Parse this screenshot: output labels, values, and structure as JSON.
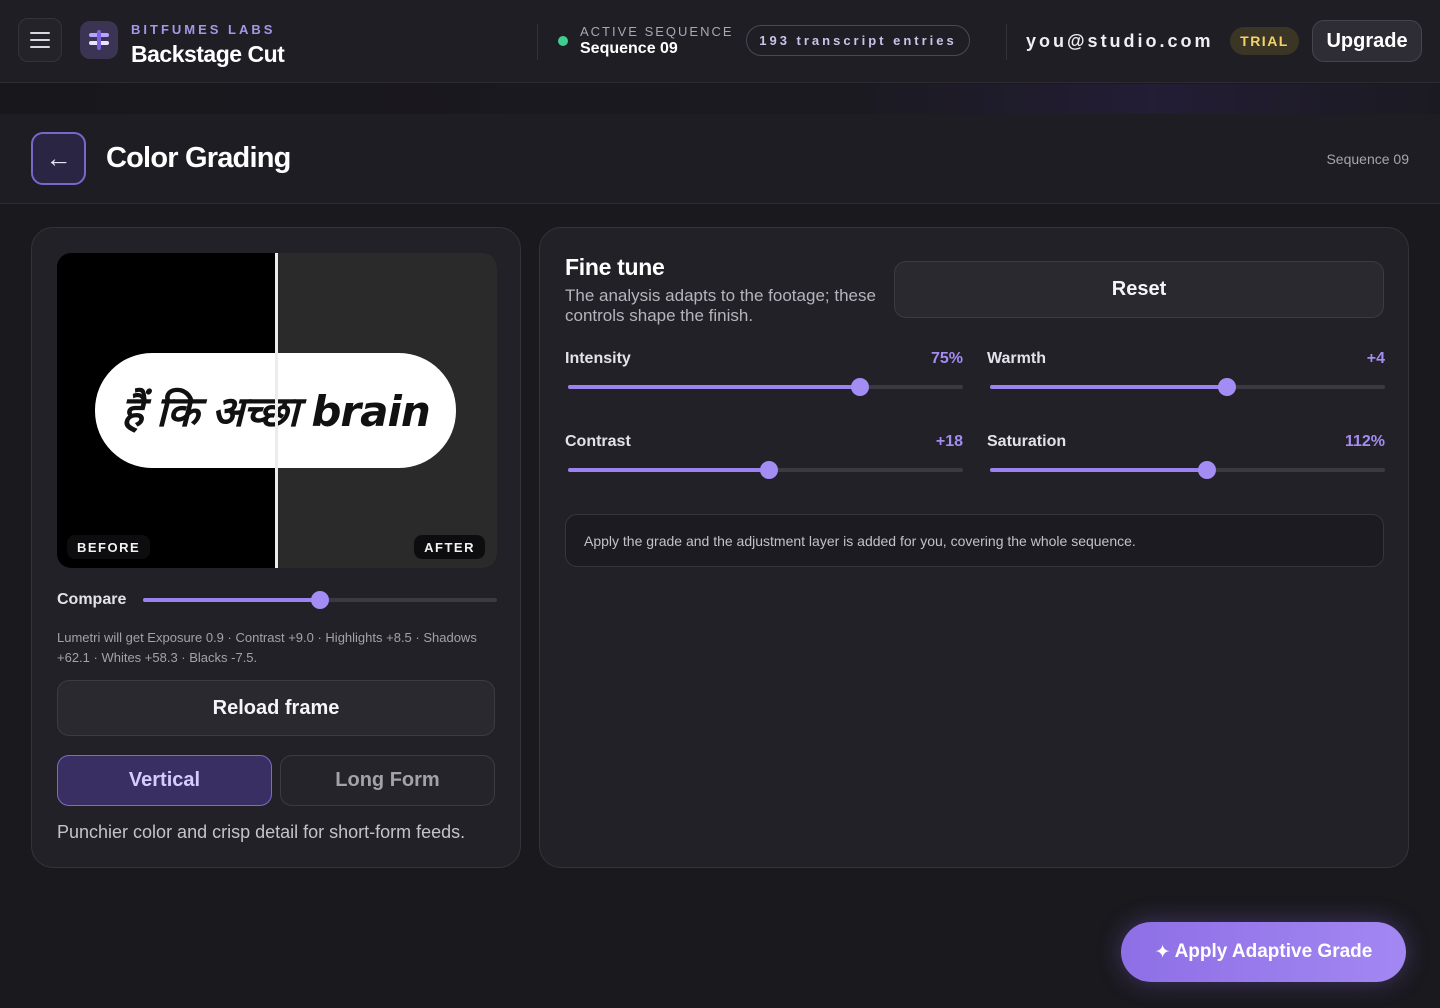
{
  "app": {
    "brand_sub": "BITFUMES LABS",
    "brand_title": "Backstage Cut"
  },
  "status": {
    "label": "ACTIVE SEQUENCE",
    "sequence": "Sequence 09",
    "entries": "193 transcript entries",
    "color": "#3ecf8e"
  },
  "account": {
    "email": "you@studio.com",
    "plan_badge": "TRIAL",
    "upgrade_label": "Upgrade"
  },
  "page": {
    "title": "Color Grading",
    "crumb": "Sequence 09",
    "back_icon": "←"
  },
  "preview": {
    "caption": "हैं कि अच्छा brain",
    "before_label": "BEFORE",
    "after_label": "AFTER",
    "compare_label": "Compare",
    "compare_value": 0.5,
    "lumetri_note": "Lumetri will get Exposure 0.9 · Contrast +9.0 · Highlights +8.5 · Shadows +62.1 · Whites +58.3 · Blacks -7.5.",
    "reload_label": "Reload frame",
    "modes": [
      {
        "label": "Vertical",
        "active": true
      },
      {
        "label": "Long Form",
        "active": false
      }
    ],
    "mode_desc": "Punchier color and crisp detail for short-form feeds."
  },
  "fine_tune": {
    "title": "Fine tune",
    "description": "The analysis adapts to the footage; these controls shape the finish.",
    "reset_label": "Reset",
    "controls": [
      {
        "label": "Intensity",
        "value": "75%",
        "level": 0.74
      },
      {
        "label": "Warmth",
        "value": "+4",
        "level": 0.6
      },
      {
        "label": "Contrast",
        "value": "+18",
        "level": 0.51
      },
      {
        "label": "Saturation",
        "value": "112%",
        "level": 0.55
      }
    ],
    "info": "Apply the grade and the adjustment layer is added for you, covering the whole sequence."
  },
  "actions": {
    "apply_icon": "✦",
    "apply_label": "Apply Adaptive Grade"
  },
  "colors": {
    "accent": "#9b82f0",
    "trial": "#f5d36b",
    "background": "#1a191e"
  }
}
